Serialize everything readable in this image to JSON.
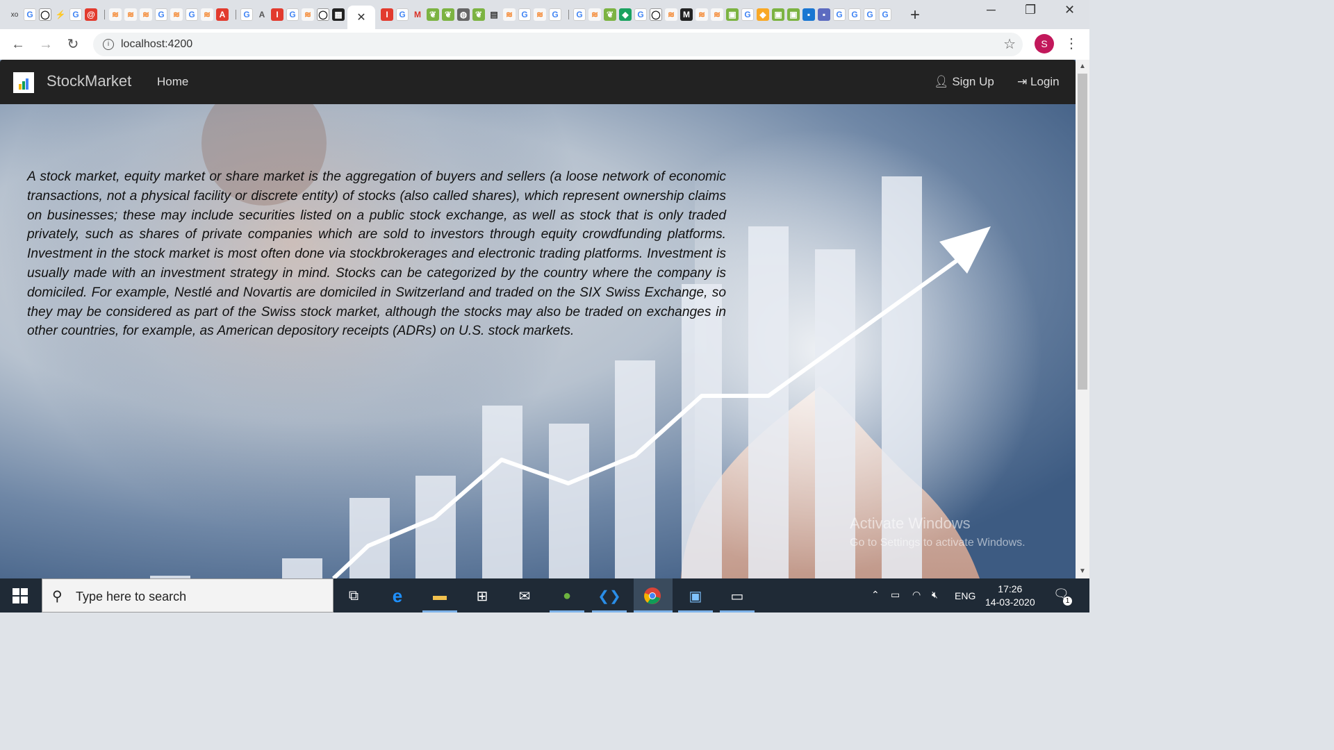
{
  "browser": {
    "active_tab_close": "✕",
    "new_tab": "+",
    "url": "localhost:4200",
    "profile_initial": "S",
    "window_controls": {
      "minimize": "─",
      "restore": "❐",
      "close": "✕"
    }
  },
  "app": {
    "brand": "StockMarket",
    "nav": {
      "home": "Home",
      "signup": "Sign Up",
      "login": "Login"
    },
    "description": "A stock market, equity market or share market is the aggregation of buyers and sellers (a loose network of economic transactions, not a physical facility or discrete entity) of stocks (also called shares), which represent ownership claims on businesses; these may include securities listed on a public stock exchange, as well as stock that is only traded privately, such as shares of private companies which are sold to investors through equity crowdfunding platforms. Investment in the stock market is most often done via stockbrokerages and electronic trading platforms. Investment is usually made with an investment strategy in mind. Stocks can be categorized by the country where the company is domiciled. For example, Nestlé and Novartis are domiciled in Switzerland and traded on the SIX Swiss Exchange, so they may be considered as part of the Swiss stock market, although the stocks may also be traded on exchanges in other countries, for example, as American depository receipts (ADRs) on U.S. stock markets."
  },
  "windows": {
    "activate_title": "Activate Windows",
    "activate_sub": "Go to Settings to activate Windows."
  },
  "taskbar": {
    "search_placeholder": "Type here to search",
    "language": "ENG",
    "time": "17:26",
    "date": "14-03-2020",
    "notification_count": "1"
  },
  "colors": {
    "navbar": "#222222",
    "taskbar": "#1f2a36",
    "avatar": "#c2185b"
  }
}
